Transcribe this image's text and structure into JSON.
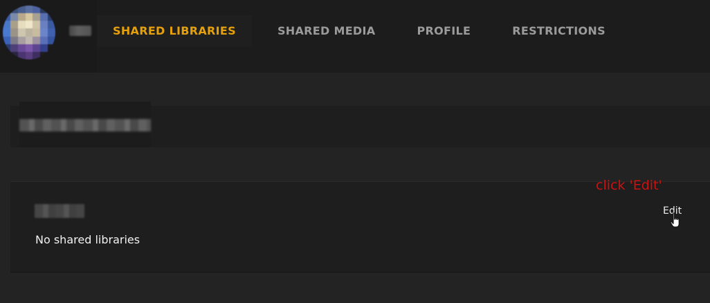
{
  "tabs": [
    {
      "label": "SHARED LIBRARIES",
      "active": true
    },
    {
      "label": "SHARED MEDIA",
      "active": false
    },
    {
      "label": "PROFILE",
      "active": false
    },
    {
      "label": "RESTRICTIONS",
      "active": false
    }
  ],
  "shared_libraries": {
    "empty_text": "No shared libraries",
    "edit_label": "Edit"
  },
  "annotation": {
    "text": "click 'Edit'",
    "color": "#cc1111"
  },
  "colors": {
    "accent": "#e5a00d",
    "tab_inactive": "#9b9b9b",
    "background": "#232323"
  },
  "icons": {
    "cursor": "hand-pointer-icon",
    "avatar": "user-avatar"
  }
}
